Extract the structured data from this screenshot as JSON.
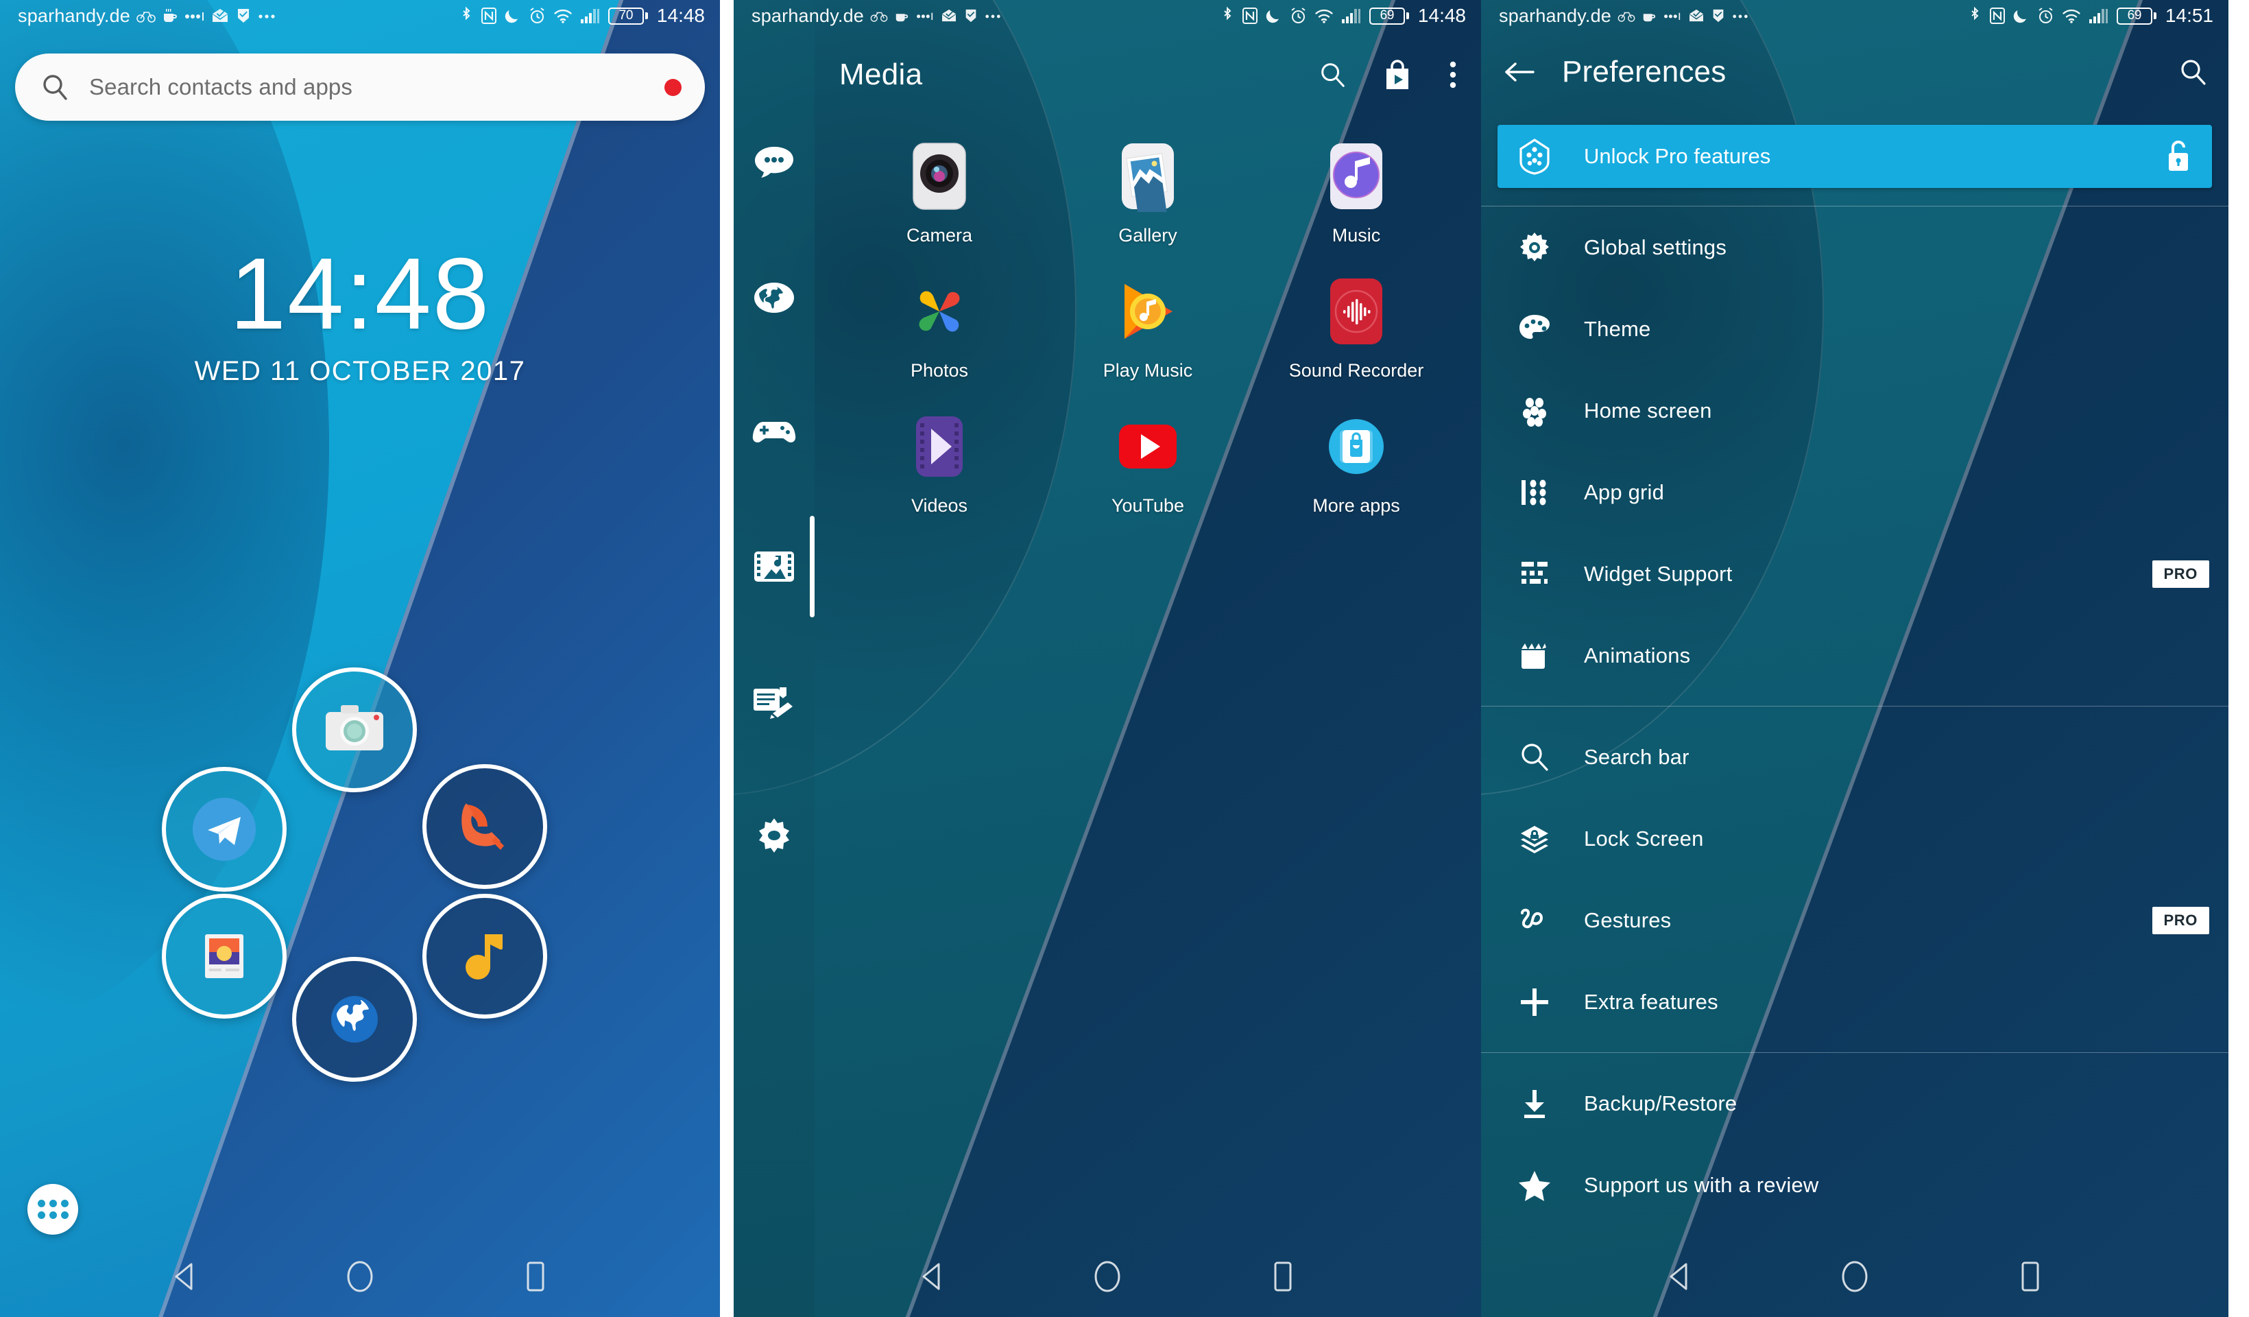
{
  "status_bar": {
    "carrier": "sparhandy.de",
    "left_icons": [
      "bicycle-icon",
      "coffee-cup-icon",
      "more-dots-icon",
      "mail-icon",
      "checkmark-flag-icon",
      "overflow-dots-icon"
    ],
    "right_icons": [
      "bluetooth-icon",
      "nfc-icon",
      "do-not-disturb-moon-icon",
      "alarm-clock-icon",
      "wifi-icon",
      "cellular-signal-icon"
    ],
    "battery_home": "70",
    "battery_drawer": "69",
    "battery_prefs": "69",
    "time_home": "14:48",
    "time_drawer": "14:48",
    "time_prefs": "14:51"
  },
  "home": {
    "search": {
      "placeholder": "Search contacts and apps",
      "value": "",
      "icon": "search-icon",
      "indicator_color": "#e8212a"
    },
    "clock_widget": {
      "time": "14:48",
      "date": "WED 11 OCTOBER 2017"
    },
    "ring_icons": [
      {
        "name": "camera",
        "label": "Camera"
      },
      {
        "name": "telegram",
        "label": "Telegram"
      },
      {
        "name": "phone",
        "label": "Phone"
      },
      {
        "name": "gallery",
        "label": "Gallery"
      },
      {
        "name": "browser",
        "label": "Browser"
      },
      {
        "name": "music",
        "label": "Music"
      }
    ],
    "app_drawer_button": "app-drawer-icon"
  },
  "drawer": {
    "title": "Media",
    "actions": [
      "search-icon",
      "play-store-bag-icon",
      "overflow-menu-icon"
    ],
    "categories": [
      {
        "name": "communication",
        "icon": "chat-bubble-icon",
        "selected": false
      },
      {
        "name": "internet",
        "icon": "globe-icon",
        "selected": false
      },
      {
        "name": "games",
        "icon": "gamepad-icon",
        "selected": false
      },
      {
        "name": "media",
        "icon": "media-film-icon",
        "selected": true
      },
      {
        "name": "documents",
        "icon": "document-edit-icon",
        "selected": false
      },
      {
        "name": "tools",
        "icon": "gear-icon",
        "selected": false
      }
    ],
    "apps": [
      {
        "label": "Camera",
        "icon": "camera-app-icon"
      },
      {
        "label": "Gallery",
        "icon": "gallery-app-icon"
      },
      {
        "label": "Music",
        "icon": "music-app-icon"
      },
      {
        "label": "Photos",
        "icon": "google-photos-icon"
      },
      {
        "label": "Play Music",
        "icon": "play-music-icon"
      },
      {
        "label": "Sound Recorder",
        "icon": "sound-recorder-icon"
      },
      {
        "label": "Videos",
        "icon": "videos-app-icon"
      },
      {
        "label": "YouTube",
        "icon": "youtube-icon"
      },
      {
        "label": "More apps",
        "icon": "more-apps-icon"
      }
    ]
  },
  "preferences": {
    "title": "Preferences",
    "back_icon": "back-arrow-icon",
    "search_icon": "search-icon",
    "banner": {
      "label": "Unlock Pro features",
      "icon": "pro-shield-icon",
      "trailing_icon": "unlock-padlock-icon",
      "color": "#16ace0"
    },
    "group1": [
      {
        "label": "Global settings",
        "icon": "gear-icon",
        "badge": ""
      },
      {
        "label": "Theme",
        "icon": "palette-icon",
        "badge": ""
      },
      {
        "label": "Home screen",
        "icon": "home-dots-icon",
        "badge": ""
      },
      {
        "label": "App grid",
        "icon": "app-grid-icon",
        "badge": ""
      },
      {
        "label": "Widget Support",
        "icon": "widget-icon",
        "badge": "PRO"
      },
      {
        "label": "Animations",
        "icon": "film-clapper-icon",
        "badge": ""
      }
    ],
    "group2": [
      {
        "label": "Search bar",
        "icon": "search-icon",
        "badge": ""
      },
      {
        "label": "Lock Screen",
        "icon": "layers-icon",
        "badge": ""
      },
      {
        "label": "Gestures",
        "icon": "gesture-squiggle-icon",
        "badge": "PRO"
      },
      {
        "label": "Extra features",
        "icon": "plus-icon",
        "badge": ""
      }
    ],
    "group3": [
      {
        "label": "Backup/Restore",
        "icon": "download-icon",
        "badge": ""
      },
      {
        "label": "Support us with a review",
        "icon": "star-icon",
        "badge": ""
      }
    ]
  },
  "nav_bar": {
    "back": "back-triangle-icon",
    "home": "home-circle-icon",
    "recents": "recents-square-icon"
  }
}
